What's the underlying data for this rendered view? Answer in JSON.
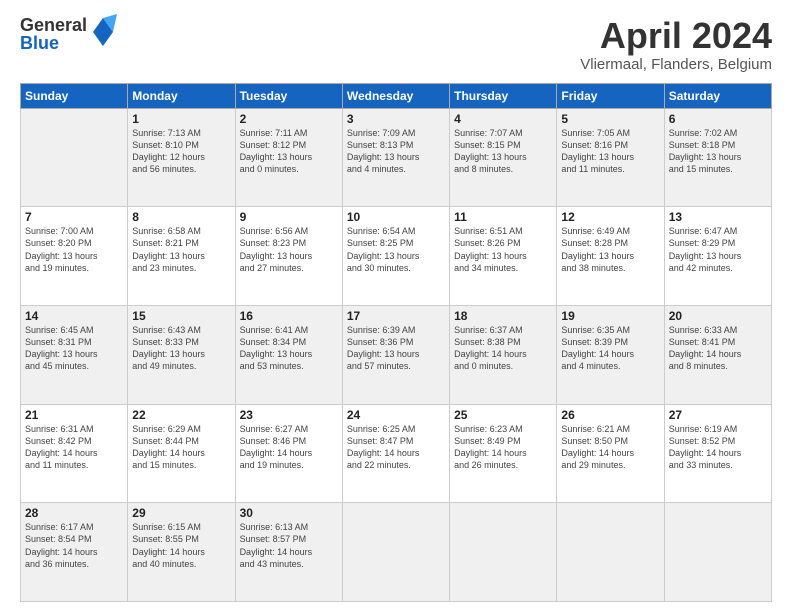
{
  "header": {
    "logo_general": "General",
    "logo_blue": "Blue",
    "title": "April 2024",
    "location": "Vliermaal, Flanders, Belgium"
  },
  "days_of_week": [
    "Sunday",
    "Monday",
    "Tuesday",
    "Wednesday",
    "Thursday",
    "Friday",
    "Saturday"
  ],
  "weeks": [
    [
      {
        "day": "",
        "info": ""
      },
      {
        "day": "1",
        "info": "Sunrise: 7:13 AM\nSunset: 8:10 PM\nDaylight: 12 hours\nand 56 minutes."
      },
      {
        "day": "2",
        "info": "Sunrise: 7:11 AM\nSunset: 8:12 PM\nDaylight: 13 hours\nand 0 minutes."
      },
      {
        "day": "3",
        "info": "Sunrise: 7:09 AM\nSunset: 8:13 PM\nDaylight: 13 hours\nand 4 minutes."
      },
      {
        "day": "4",
        "info": "Sunrise: 7:07 AM\nSunset: 8:15 PM\nDaylight: 13 hours\nand 8 minutes."
      },
      {
        "day": "5",
        "info": "Sunrise: 7:05 AM\nSunset: 8:16 PM\nDaylight: 13 hours\nand 11 minutes."
      },
      {
        "day": "6",
        "info": "Sunrise: 7:02 AM\nSunset: 8:18 PM\nDaylight: 13 hours\nand 15 minutes."
      }
    ],
    [
      {
        "day": "7",
        "info": "Sunrise: 7:00 AM\nSunset: 8:20 PM\nDaylight: 13 hours\nand 19 minutes."
      },
      {
        "day": "8",
        "info": "Sunrise: 6:58 AM\nSunset: 8:21 PM\nDaylight: 13 hours\nand 23 minutes."
      },
      {
        "day": "9",
        "info": "Sunrise: 6:56 AM\nSunset: 8:23 PM\nDaylight: 13 hours\nand 27 minutes."
      },
      {
        "day": "10",
        "info": "Sunrise: 6:54 AM\nSunset: 8:25 PM\nDaylight: 13 hours\nand 30 minutes."
      },
      {
        "day": "11",
        "info": "Sunrise: 6:51 AM\nSunset: 8:26 PM\nDaylight: 13 hours\nand 34 minutes."
      },
      {
        "day": "12",
        "info": "Sunrise: 6:49 AM\nSunset: 8:28 PM\nDaylight: 13 hours\nand 38 minutes."
      },
      {
        "day": "13",
        "info": "Sunrise: 6:47 AM\nSunset: 8:29 PM\nDaylight: 13 hours\nand 42 minutes."
      }
    ],
    [
      {
        "day": "14",
        "info": "Sunrise: 6:45 AM\nSunset: 8:31 PM\nDaylight: 13 hours\nand 45 minutes."
      },
      {
        "day": "15",
        "info": "Sunrise: 6:43 AM\nSunset: 8:33 PM\nDaylight: 13 hours\nand 49 minutes."
      },
      {
        "day": "16",
        "info": "Sunrise: 6:41 AM\nSunset: 8:34 PM\nDaylight: 13 hours\nand 53 minutes."
      },
      {
        "day": "17",
        "info": "Sunrise: 6:39 AM\nSunset: 8:36 PM\nDaylight: 13 hours\nand 57 minutes."
      },
      {
        "day": "18",
        "info": "Sunrise: 6:37 AM\nSunset: 8:38 PM\nDaylight: 14 hours\nand 0 minutes."
      },
      {
        "day": "19",
        "info": "Sunrise: 6:35 AM\nSunset: 8:39 PM\nDaylight: 14 hours\nand 4 minutes."
      },
      {
        "day": "20",
        "info": "Sunrise: 6:33 AM\nSunset: 8:41 PM\nDaylight: 14 hours\nand 8 minutes."
      }
    ],
    [
      {
        "day": "21",
        "info": "Sunrise: 6:31 AM\nSunset: 8:42 PM\nDaylight: 14 hours\nand 11 minutes."
      },
      {
        "day": "22",
        "info": "Sunrise: 6:29 AM\nSunset: 8:44 PM\nDaylight: 14 hours\nand 15 minutes."
      },
      {
        "day": "23",
        "info": "Sunrise: 6:27 AM\nSunset: 8:46 PM\nDaylight: 14 hours\nand 19 minutes."
      },
      {
        "day": "24",
        "info": "Sunrise: 6:25 AM\nSunset: 8:47 PM\nDaylight: 14 hours\nand 22 minutes."
      },
      {
        "day": "25",
        "info": "Sunrise: 6:23 AM\nSunset: 8:49 PM\nDaylight: 14 hours\nand 26 minutes."
      },
      {
        "day": "26",
        "info": "Sunrise: 6:21 AM\nSunset: 8:50 PM\nDaylight: 14 hours\nand 29 minutes."
      },
      {
        "day": "27",
        "info": "Sunrise: 6:19 AM\nSunset: 8:52 PM\nDaylight: 14 hours\nand 33 minutes."
      }
    ],
    [
      {
        "day": "28",
        "info": "Sunrise: 6:17 AM\nSunset: 8:54 PM\nDaylight: 14 hours\nand 36 minutes."
      },
      {
        "day": "29",
        "info": "Sunrise: 6:15 AM\nSunset: 8:55 PM\nDaylight: 14 hours\nand 40 minutes."
      },
      {
        "day": "30",
        "info": "Sunrise: 6:13 AM\nSunset: 8:57 PM\nDaylight: 14 hours\nand 43 minutes."
      },
      {
        "day": "",
        "info": ""
      },
      {
        "day": "",
        "info": ""
      },
      {
        "day": "",
        "info": ""
      },
      {
        "day": "",
        "info": ""
      }
    ]
  ]
}
